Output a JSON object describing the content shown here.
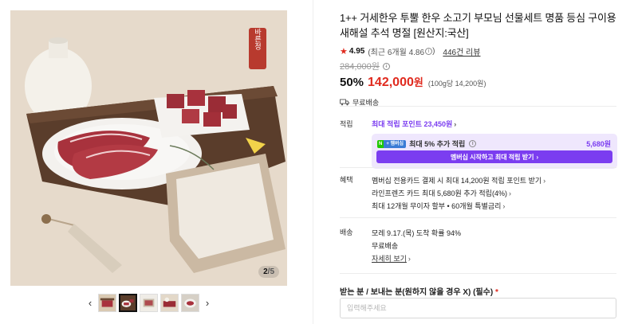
{
  "gallery": {
    "page_current": "2",
    "page_total": "5",
    "brand_seal": "바른정",
    "thumbnail_count": 5,
    "active_thumbnail": 2
  },
  "product": {
    "title": "1++ 거세한우 투뿔 한우 소고기 부모님 선물세트 명품 등심 구이용 새해설 추석 명절 [원산지:국산]",
    "rating": "4.95",
    "rating_sub": "(최근 6개월 4.86",
    "rating_sub_close": ")",
    "review_link": "446건 리뷰",
    "original_price": "284,000원",
    "discount": "50%",
    "price": "142,000",
    "price_unit": "원",
    "unit_price": "(100g당 14,200원)",
    "shipping": "무료배송"
  },
  "points": {
    "label": "적립",
    "max_points": "최대 적립 포인트 23,450원",
    "badge_n": "N",
    "badge_m": "+ 멤버십",
    "member_text": "최대 5% 추가 적립",
    "member_amount": "5,680원",
    "member_button": "멤버십 시작하고 최대 적립 받기"
  },
  "benefits": {
    "label": "혜택",
    "items": [
      "멤버십 전용카드 결제 시 최대 14,200원 적립 포인트 받기",
      "라인프렌즈 카드 최대 5,680원 추가 적립(4%)",
      "최대 12개월 무이자 할부 • 60개월 특별금리"
    ]
  },
  "delivery": {
    "label": "배송",
    "arrival": "모레 9.17.(목) 도착 확률 94%",
    "fee": "무료배송",
    "detail_link": "자세히 보기"
  },
  "recipient": {
    "label": "받는 분 / 보내는 분(원하지 않을 경우 X) (필수)",
    "required_mark": "*",
    "placeholder": "입력해주세요"
  },
  "colors": {
    "price_red": "#e02a1e",
    "accent_purple": "#7b3df0",
    "member_bg": "#efe7fd"
  }
}
